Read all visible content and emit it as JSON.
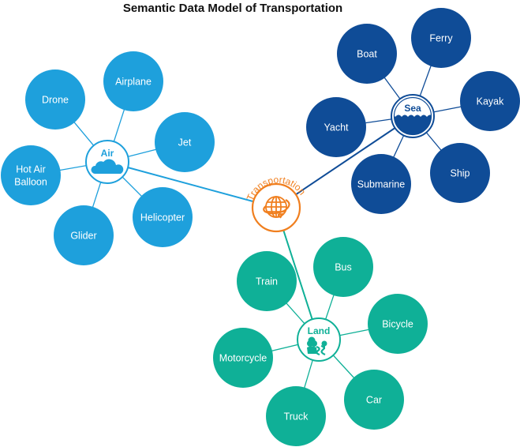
{
  "title": "Semantic Data Model of Transportation",
  "colors": {
    "air": "#1ea0dc",
    "sea": "#0f4c97",
    "land": "#0fb097",
    "root": "#f07f1f"
  },
  "root": {
    "label": "Transportation",
    "icon": "globe-arrow-icon"
  },
  "groups": [
    {
      "id": "air",
      "label": "Air",
      "icon": "cloud-icon",
      "items": [
        "Drone",
        "Airplane",
        "Jet",
        "Hot Air Balloon",
        "Glider",
        "Helicopter"
      ]
    },
    {
      "id": "sea",
      "label": "Sea",
      "icon": "waves-icon",
      "items": [
        "Boat",
        "Ferry",
        "Kayak",
        "Yacht",
        "Submarine",
        "Ship"
      ]
    },
    {
      "id": "land",
      "label": "Land",
      "icon": "trees-road-icon",
      "items": [
        "Train",
        "Bus",
        "Bicycle",
        "Motorcycle",
        "Truck",
        "Car"
      ]
    }
  ]
}
